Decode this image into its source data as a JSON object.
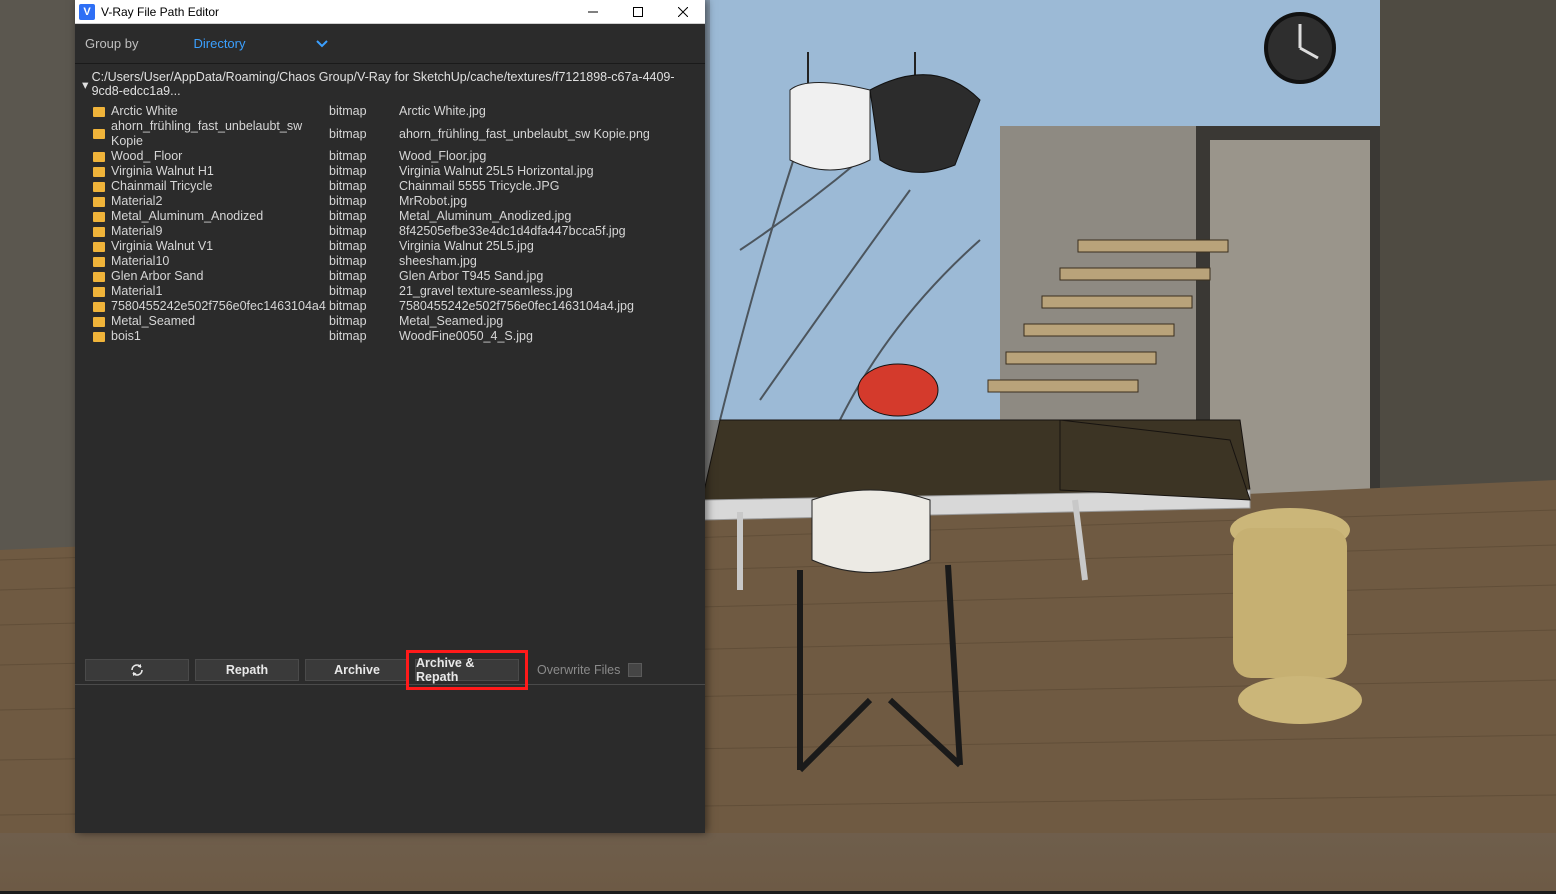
{
  "window": {
    "title": "V-Ray File Path Editor"
  },
  "groupby": {
    "label": "Group by",
    "value": "Directory"
  },
  "tree": {
    "path": "C:/Users/User/AppData/Roaming/Chaos Group/V-Ray for SketchUp/cache/textures/f7121898-c67a-4409-9cd8-edcc1a9..."
  },
  "files": [
    {
      "name": "Arctic White",
      "type": "bitmap",
      "file": "Arctic White.jpg"
    },
    {
      "name": "ahorn_frühling_fast_unbelaubt_sw Kopie",
      "type": "bitmap",
      "file": "ahorn_frühling_fast_unbelaubt_sw Kopie.png"
    },
    {
      "name": "Wood_ Floor",
      "type": "bitmap",
      "file": "Wood_Floor.jpg"
    },
    {
      "name": "Virginia Walnut H1",
      "type": "bitmap",
      "file": "Virginia Walnut 25L5 Horizontal.jpg"
    },
    {
      "name": "Chainmail Tricycle",
      "type": "bitmap",
      "file": "Chainmail 5555 Tricycle.JPG"
    },
    {
      "name": "Material2",
      "type": "bitmap",
      "file": "MrRobot.jpg"
    },
    {
      "name": "Metal_Aluminum_Anodized",
      "type": "bitmap",
      "file": "Metal_Aluminum_Anodized.jpg"
    },
    {
      "name": "Material9",
      "type": "bitmap",
      "file": "8f42505efbe33e4dc1d4dfa447bcca5f.jpg"
    },
    {
      "name": "Virginia Walnut V1",
      "type": "bitmap",
      "file": "Virginia Walnut 25L5.jpg"
    },
    {
      "name": "Material10",
      "type": "bitmap",
      "file": "sheesham.jpg"
    },
    {
      "name": "Glen Arbor Sand",
      "type": "bitmap",
      "file": "Glen Arbor T945 Sand.jpg"
    },
    {
      "name": "Material1",
      "type": "bitmap",
      "file": "21_gravel texture-seamless.jpg"
    },
    {
      "name": "7580455242e502f756e0fec1463104a4",
      "type": "bitmap",
      "file": "7580455242e502f756e0fec1463104a4.jpg"
    },
    {
      "name": "Metal_Seamed",
      "type": "bitmap",
      "file": "Metal_Seamed.jpg"
    },
    {
      "name": "bois1",
      "type": "bitmap",
      "file": "WoodFine0050_4_S.jpg"
    }
  ],
  "buttons": {
    "repath": "Repath",
    "archive": "Archive",
    "archive_repath": "Archive & Repath",
    "overwrite": "Overwrite Files"
  }
}
